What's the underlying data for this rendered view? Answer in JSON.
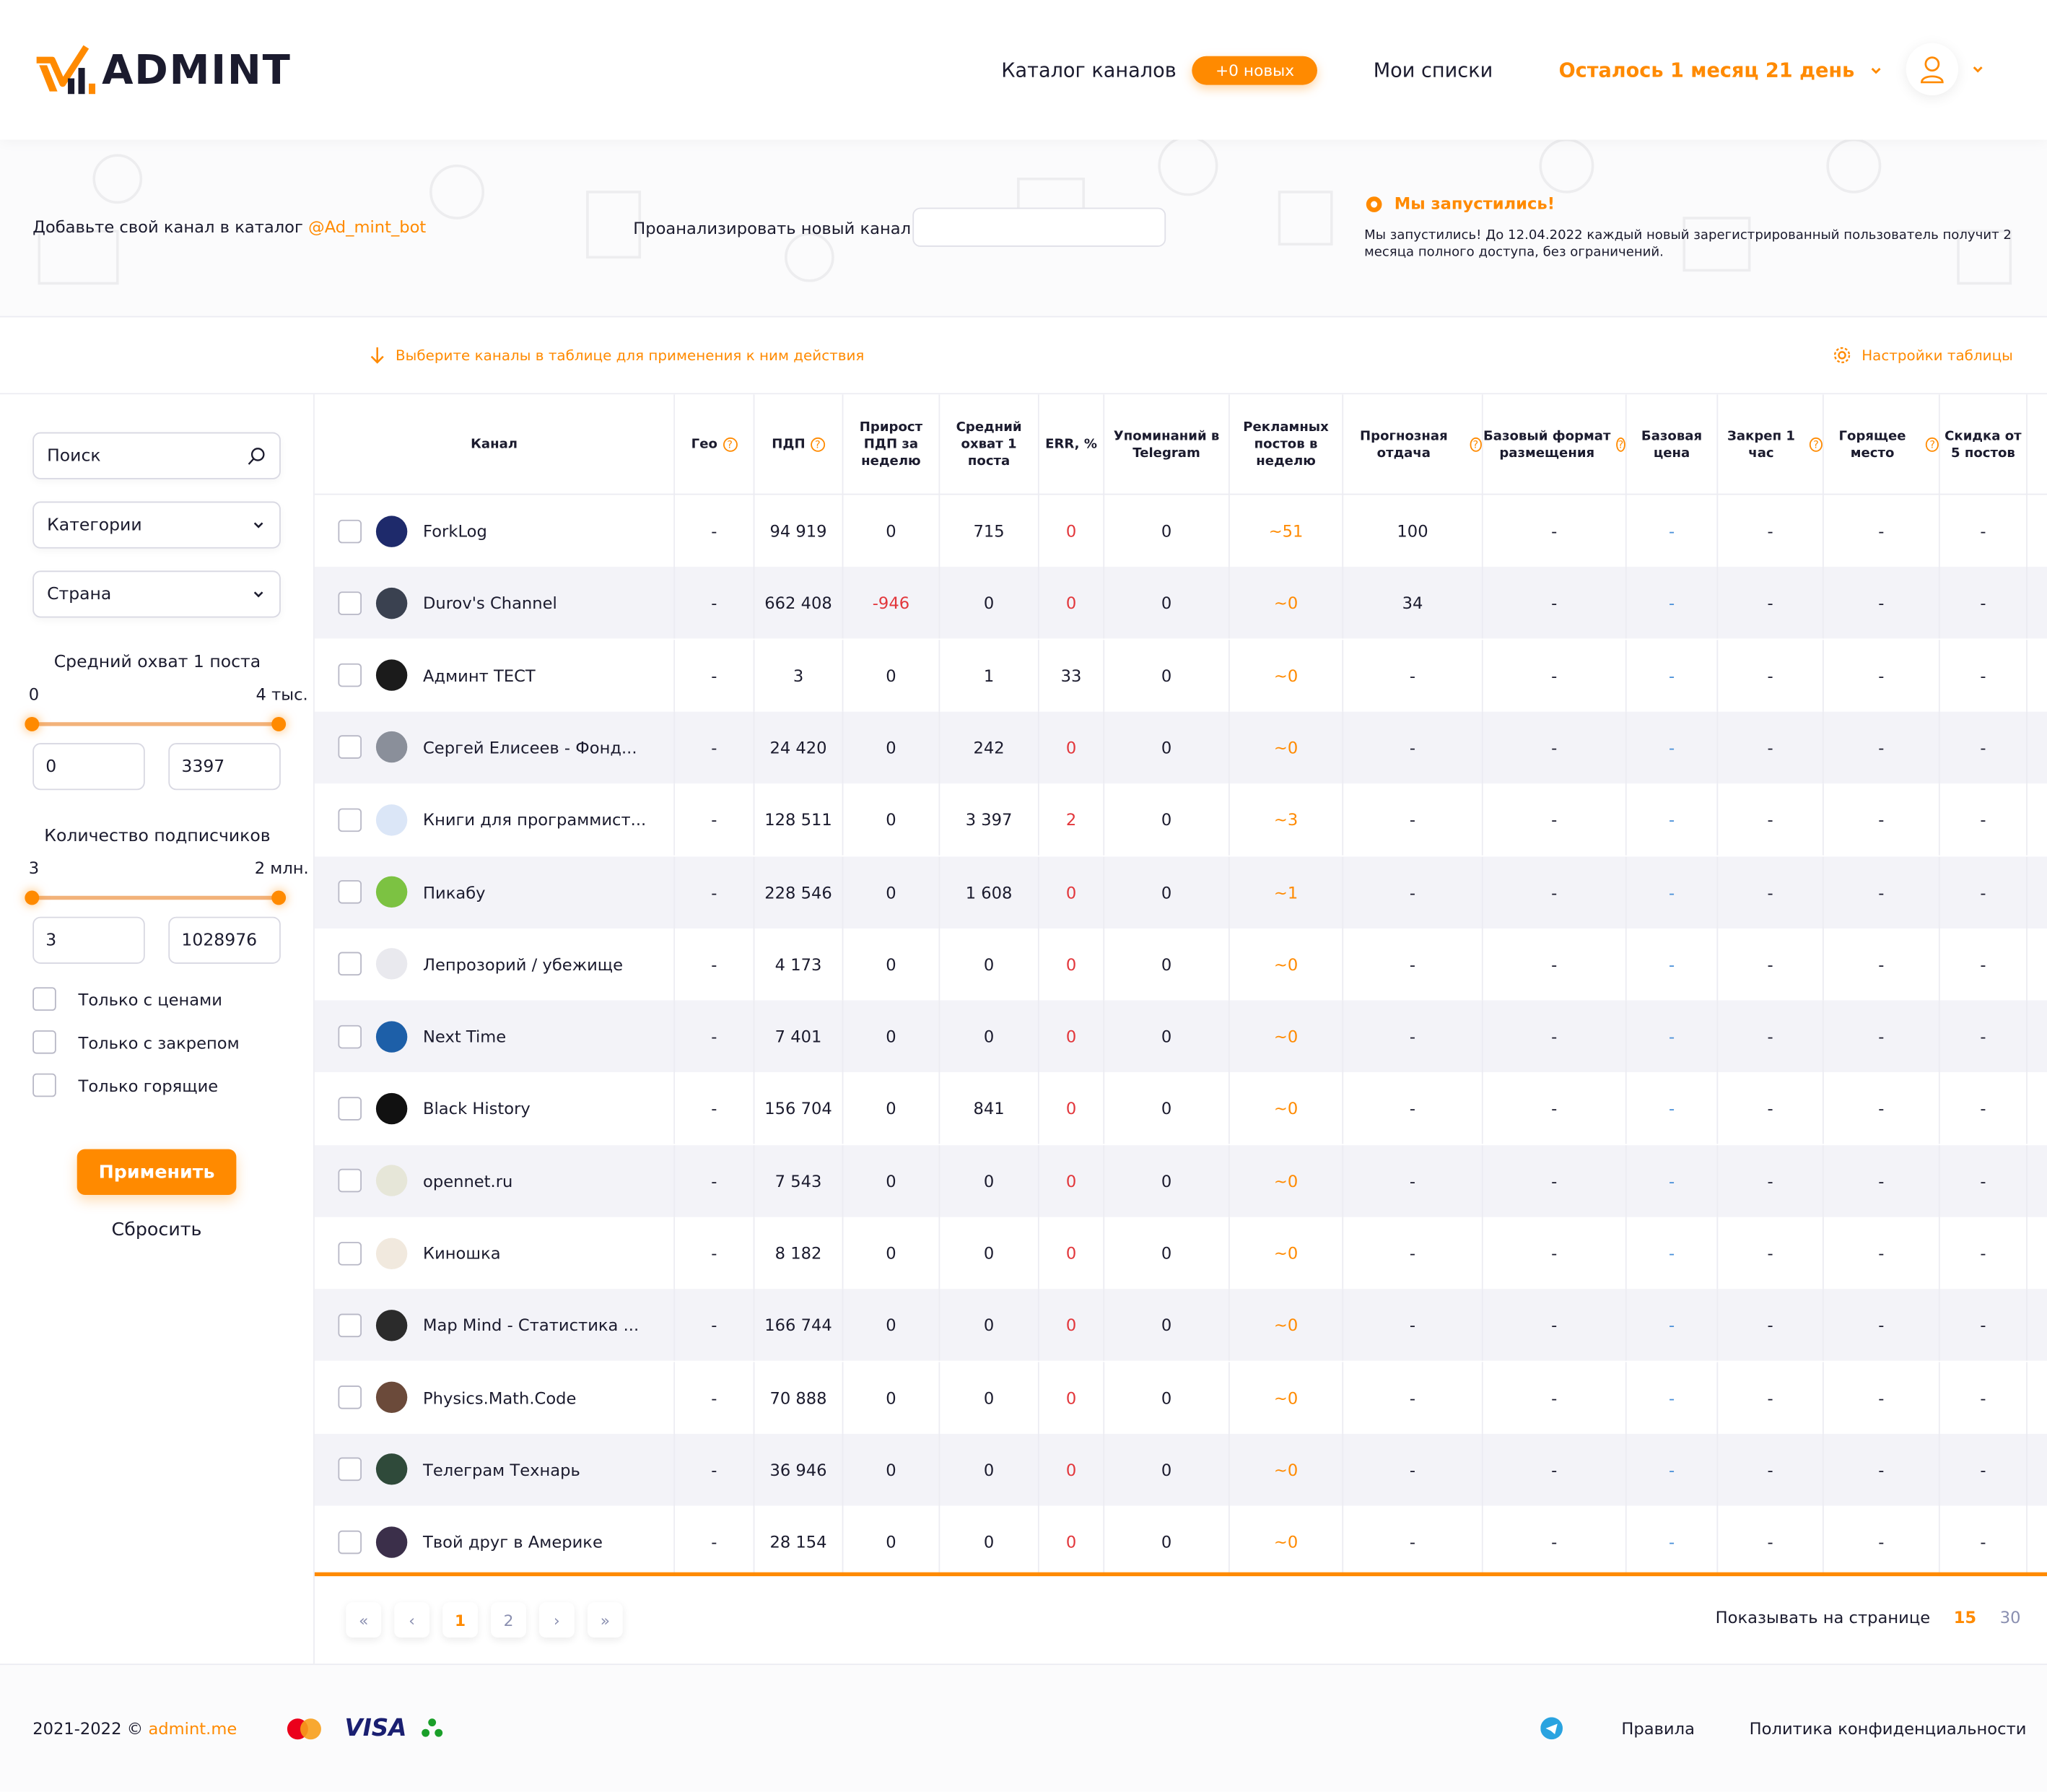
{
  "header": {
    "logo_text": "ADMINT",
    "nav_catalog": "Каталог каналов",
    "nav_badge": "+0 новых",
    "nav_lists": "Мои списки",
    "remaining": "Осталось 1 месяц 21 день",
    "icons": [
      "logo-icon",
      "chevron-down-icon",
      "user-icon"
    ]
  },
  "promo": {
    "add_channel_text": "Добавьте свой канал в каталог",
    "bot_link": "@Ad_mint_bot",
    "analyze_label": "Проанализировать новый канал",
    "analyze_value": "",
    "launch_title": "Мы запустились!",
    "launch_body": "Мы запустились! До 12.04.2022 каждый новый зарегистрированный пользователь получит 2 месяца полного доступа, без ограничений."
  },
  "actionbar": {
    "hint": "Выберите каналы в таблице для применения к ним действия",
    "settings": "Настройки таблицы"
  },
  "filters": {
    "search_placeholder": "Поиск",
    "categories": "Категории",
    "country": "Страна",
    "reach_title": "Средний охват 1 поста",
    "reach_min_label": "0",
    "reach_max_label": "4 тыс.",
    "reach_from": "0",
    "reach_to": "3397",
    "subs_title": "Количество подписчиков",
    "subs_min_label": "3",
    "subs_max_label": "2 млн.",
    "subs_from": "3",
    "subs_to": "1028976",
    "only_prices": "Только с ценами",
    "only_pinned": "Только с закрепом",
    "only_hot": "Только горящие",
    "apply": "Применить",
    "reset": "Сбросить"
  },
  "table": {
    "headers": [
      "Канал",
      "Гео",
      "ПДП",
      "Прирост ПДП за неделю",
      "Средний охват 1 поста",
      "ERR, %",
      "Упоминаний в Telegram",
      "Рекламных постов в неделю",
      "Прогнозная отдача",
      "Базовый формат размещения",
      "Базовая цена",
      "Закреп 1 час",
      "Горящее место",
      "Скидка от 5 постов"
    ],
    "rows": [
      {
        "name": "ForkLog",
        "geo": "-",
        "pdp": "94 919",
        "growth": "0",
        "reach": "715",
        "err": "0",
        "mentions": "0",
        "ads": "~51",
        "forecast": "100",
        "format": "-",
        "price": "-",
        "pin": "-",
        "hot": "-",
        "discount": "-",
        "avatar_color": "#1e2a6b"
      },
      {
        "name": "Durov's Channel",
        "geo": "-",
        "pdp": "662 408",
        "growth": "-946",
        "reach": "0",
        "err": "0",
        "mentions": "0",
        "ads": "~0",
        "forecast": "34",
        "format": "-",
        "price": "-",
        "pin": "-",
        "hot": "-",
        "discount": "-",
        "avatar_color": "#3a4150"
      },
      {
        "name": "Админт ТЕСТ",
        "geo": "-",
        "pdp": "3",
        "growth": "0",
        "reach": "1",
        "err": "33",
        "mentions": "0",
        "ads": "~0",
        "forecast": "-",
        "format": "-",
        "price": "-",
        "pin": "-",
        "hot": "-",
        "discount": "-",
        "avatar_color": "#1b1b1b"
      },
      {
        "name": "Сергей Елисеев - Фонд...",
        "geo": "-",
        "pdp": "24 420",
        "growth": "0",
        "reach": "242",
        "err": "0",
        "mentions": "0",
        "ads": "~0",
        "forecast": "-",
        "format": "-",
        "price": "-",
        "pin": "-",
        "hot": "-",
        "discount": "-",
        "avatar_color": "#8a8f9a"
      },
      {
        "name": "Книги для программист...",
        "geo": "-",
        "pdp": "128 511",
        "growth": "0",
        "reach": "3 397",
        "err": "2",
        "mentions": "0",
        "ads": "~3",
        "forecast": "-",
        "format": "-",
        "price": "-",
        "pin": "-",
        "hot": "-",
        "discount": "-",
        "avatar_color": "#dbe6f7"
      },
      {
        "name": "Пикабу",
        "geo": "-",
        "pdp": "228 546",
        "growth": "0",
        "reach": "1 608",
        "err": "0",
        "mentions": "0",
        "ads": "~1",
        "forecast": "-",
        "format": "-",
        "price": "-",
        "pin": "-",
        "hot": "-",
        "discount": "-",
        "avatar_color": "#7cc242"
      },
      {
        "name": "Лепрозорий / убежище",
        "geo": "-",
        "pdp": "4 173",
        "growth": "0",
        "reach": "0",
        "err": "0",
        "mentions": "0",
        "ads": "~0",
        "forecast": "-",
        "format": "-",
        "price": "-",
        "pin": "-",
        "hot": "-",
        "discount": "-",
        "avatar_color": "#e9e9ee"
      },
      {
        "name": "Next Time",
        "geo": "-",
        "pdp": "7 401",
        "growth": "0",
        "reach": "0",
        "err": "0",
        "mentions": "0",
        "ads": "~0",
        "forecast": "-",
        "format": "-",
        "price": "-",
        "pin": "-",
        "hot": "-",
        "discount": "-",
        "avatar_color": "#1d5fa8"
      },
      {
        "name": "Black History",
        "geo": "-",
        "pdp": "156 704",
        "growth": "0",
        "reach": "841",
        "err": "0",
        "mentions": "0",
        "ads": "~0",
        "forecast": "-",
        "format": "-",
        "price": "-",
        "pin": "-",
        "hot": "-",
        "discount": "-",
        "avatar_color": "#111111"
      },
      {
        "name": "opennet.ru",
        "geo": "-",
        "pdp": "7 543",
        "growth": "0",
        "reach": "0",
        "err": "0",
        "mentions": "0",
        "ads": "~0",
        "forecast": "-",
        "format": "-",
        "price": "-",
        "pin": "-",
        "hot": "-",
        "discount": "-",
        "avatar_color": "#e6e6d8"
      },
      {
        "name": "Киношка",
        "geo": "-",
        "pdp": "8 182",
        "growth": "0",
        "reach": "0",
        "err": "0",
        "mentions": "0",
        "ads": "~0",
        "forecast": "-",
        "format": "-",
        "price": "-",
        "pin": "-",
        "hot": "-",
        "discount": "-",
        "avatar_color": "#f1e9de"
      },
      {
        "name": "Map Mind - Статистика ...",
        "geo": "-",
        "pdp": "166 744",
        "growth": "0",
        "reach": "0",
        "err": "0",
        "mentions": "0",
        "ads": "~0",
        "forecast": "-",
        "format": "-",
        "price": "-",
        "pin": "-",
        "hot": "-",
        "discount": "-",
        "avatar_color": "#2b2b2b"
      },
      {
        "name": "Physics.Math.Code",
        "geo": "-",
        "pdp": "70 888",
        "growth": "0",
        "reach": "0",
        "err": "0",
        "mentions": "0",
        "ads": "~0",
        "forecast": "-",
        "format": "-",
        "price": "-",
        "pin": "-",
        "hot": "-",
        "discount": "-",
        "avatar_color": "#6b4a3a"
      },
      {
        "name": "Телеграм Технарь",
        "geo": "-",
        "pdp": "36 946",
        "growth": "0",
        "reach": "0",
        "err": "0",
        "mentions": "0",
        "ads": "~0",
        "forecast": "-",
        "format": "-",
        "price": "-",
        "pin": "-",
        "hot": "-",
        "discount": "-",
        "avatar_color": "#2f4a3a"
      },
      {
        "name": "Твой друг в Америке",
        "geo": "-",
        "pdp": "28 154",
        "growth": "0",
        "reach": "0",
        "err": "0",
        "mentions": "0",
        "ads": "~0",
        "forecast": "-",
        "format": "-",
        "price": "-",
        "pin": "-",
        "hot": "-",
        "discount": "-",
        "avatar_color": "#3b2f4a"
      }
    ]
  },
  "pagination": {
    "pages": [
      "1",
      "2"
    ],
    "current": "1",
    "per_page_label": "Показывать на странице",
    "per_page_options": [
      "15",
      "30"
    ],
    "per_page_selected": "15"
  },
  "footer": {
    "copyright": "2021-2022 ©",
    "site_link": "admint.me",
    "payment_icons": [
      "mastercard-icon",
      "visa-icon",
      "sberbank-icon"
    ],
    "visa_text": "VISA",
    "rules": "Правила",
    "privacy": "Политика конфиденциальности"
  },
  "colors": {
    "accent": "#ff8a00",
    "text": "#1b1b2e",
    "negative": "#e2363b",
    "link_blue": "#4a90d9",
    "alt_row": "#f3f3f8"
  }
}
